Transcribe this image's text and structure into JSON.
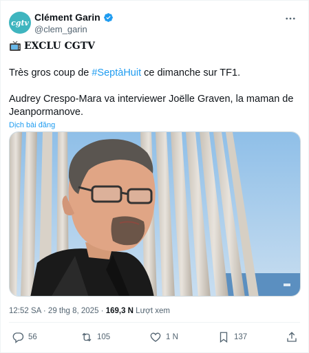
{
  "author": {
    "avatar_text": "cgtv",
    "display_name": "Clément Garin",
    "handle": "@clem_garin"
  },
  "tweet": {
    "exclu_label": "EXCLU CGTV",
    "line1_before": "Très gros coup de ",
    "line1_hashtag": "#SeptàHuit",
    "line1_after": " ce dimanche sur TF1.",
    "line2": "Audrey Crespo-Mara va interviewer Joëlle Graven, la maman de Jeanpormanove.",
    "translate_label": "Dịch bài đăng"
  },
  "meta": {
    "time": "12:52 SA",
    "separator": " · ",
    "date": "29 thg 8, 2025",
    "views_count": "169,3 N",
    "views_label": " Lượt xem"
  },
  "actions": {
    "replies": "56",
    "reposts": "105",
    "likes": "1 N",
    "bookmarks": "137"
  },
  "colors": {
    "accent": "#1d9bf0",
    "secondary_text": "#536471",
    "avatar_bg": "#3fb5bf"
  }
}
